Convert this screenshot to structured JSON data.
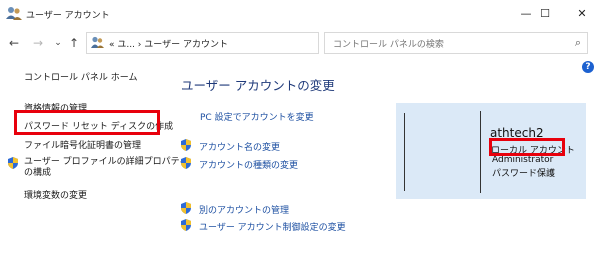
{
  "window": {
    "title": "ユーザー アカウント",
    "minimize_icon": "—",
    "maximize_icon": "☐",
    "close_icon": "✕"
  },
  "nav": {
    "back_icon": "←",
    "forward_icon": "→",
    "recent_icon": "⌄",
    "up_icon": "↑"
  },
  "address": {
    "path": "« ユ... › ユーザー アカウント",
    "dropdown_icon": "⌄",
    "refresh_icon": "↻"
  },
  "search": {
    "placeholder": "コントロール パネルの検索",
    "icon": "⌕"
  },
  "help": {
    "label": "?"
  },
  "left_pane": {
    "home": "コントロール パネル ホーム",
    "credentials": "資格情報の管理",
    "password_reset_disk": "パスワード リセット ディスクの作成",
    "file_encryption": "ファイル暗号化証明書の管理",
    "profile_line1": "ユーザー プロファイルの詳細プロパティ",
    "profile_line2": "の構成",
    "env_vars": "環境変数の変更"
  },
  "main": {
    "title": "ユーザー アカウントの変更",
    "pc_settings": "PC 設定でアカウントを変更",
    "change_name": "アカウント名の変更",
    "change_type": "アカウントの種類の変更",
    "manage_other": "別のアカウントの管理",
    "uac": "ユーザー アカウント制御設定の変更"
  },
  "account": {
    "name": "athtech2",
    "type": "ローカル アカウント",
    "role": "Administrator",
    "password": "パスワード保護"
  },
  "colors": {
    "highlight": "#e8000c",
    "link": "#1e50a2",
    "title": "#1f3a7a",
    "panel": "#dbe9f7"
  }
}
